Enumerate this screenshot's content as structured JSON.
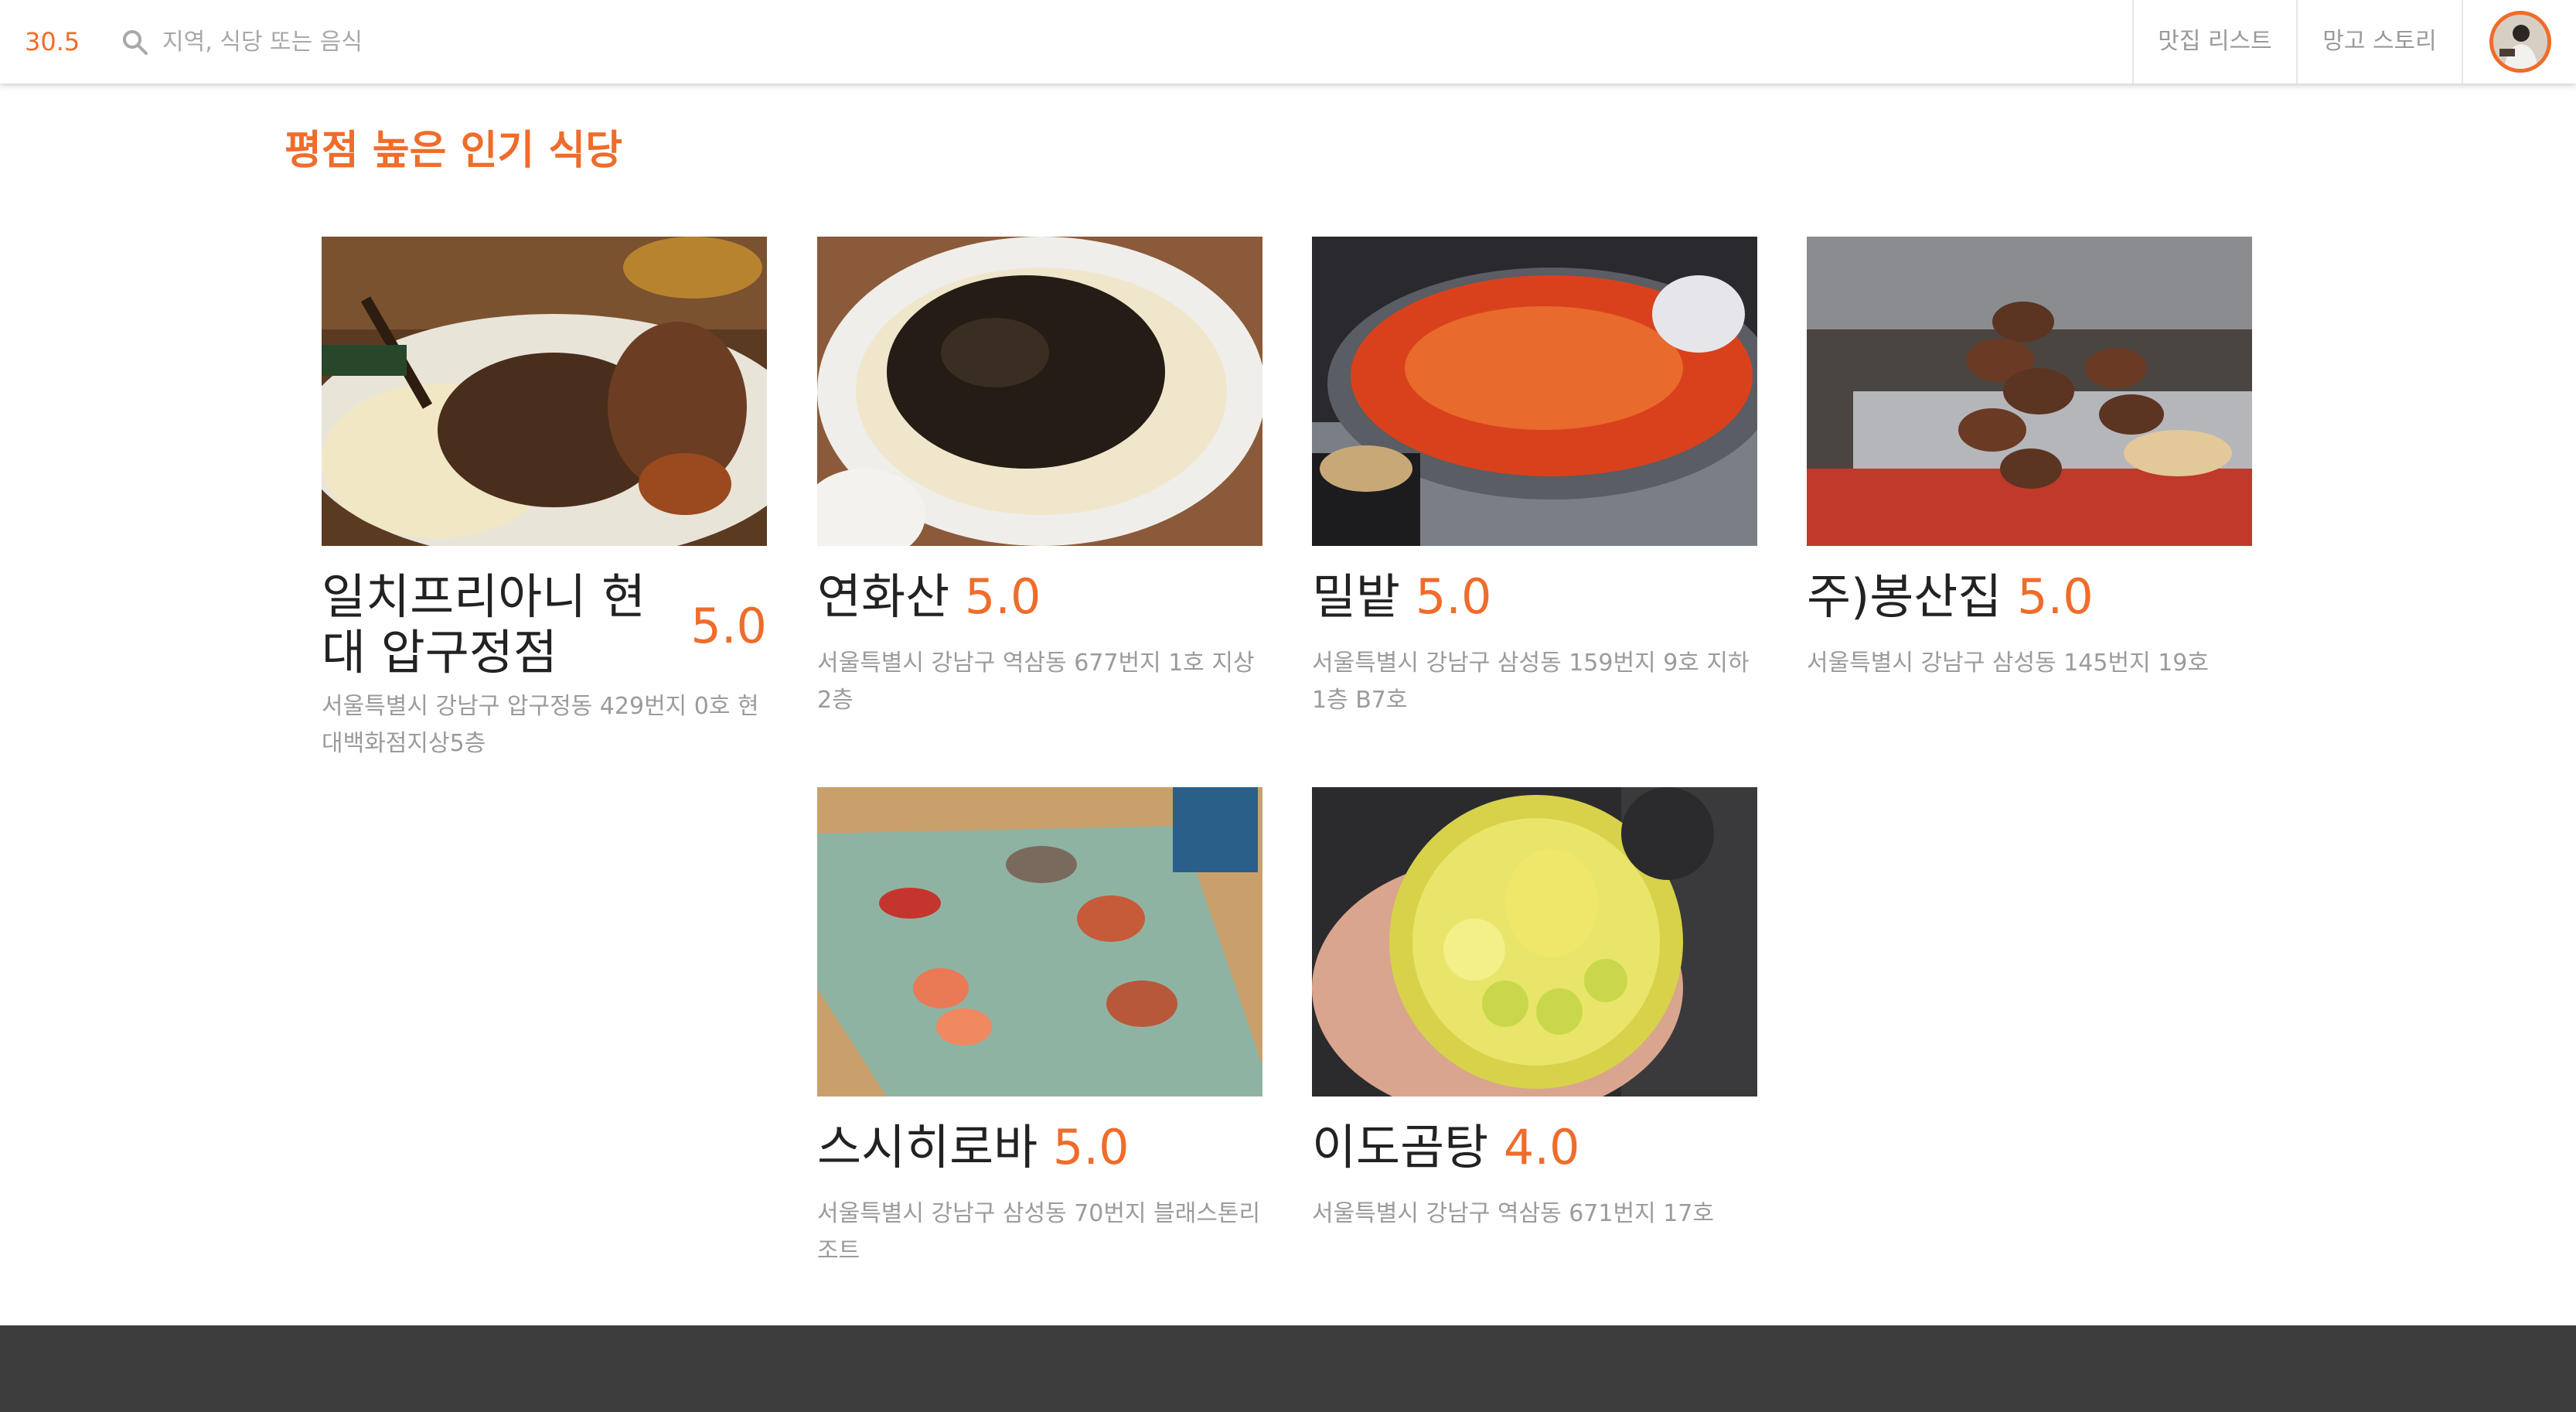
{
  "header": {
    "logo": "30.5",
    "search_placeholder": "지역, 식당 또는 음식",
    "nav": [
      "맛집 리스트",
      "망고 스토리"
    ]
  },
  "section_title": "평점 높은 인기 식당",
  "restaurants": [
    {
      "name": "일치프리아니 현대 압구정점",
      "rating": "5.0",
      "address": "서울특별시 강남구 압구정동 429번지 0호 현대백화점지상5층"
    },
    {
      "name": "연화산",
      "rating": "5.0",
      "address": "서울특별시 강남구 역삼동 677번지 1호 지상2층"
    },
    {
      "name": "밀밭",
      "rating": "5.0",
      "address": "서울특별시 강남구 삼성동 159번지 9호 지하1층 B7호"
    },
    {
      "name": "주)봉산집",
      "rating": "5.0",
      "address": "서울특별시 강남구 삼성동 145번지 19호"
    },
    {
      "name": "스시히로바",
      "rating": "5.0",
      "address": "서울특별시 강남구 삼성동 70번지 블래스톤리조트"
    },
    {
      "name": "이도곰탕",
      "rating": "4.0",
      "address": "서울특별시 강남구 역삼동 671번지 17호"
    }
  ],
  "colors": {
    "accent": "#ef6c2a",
    "footer": "#3d3d3d"
  }
}
